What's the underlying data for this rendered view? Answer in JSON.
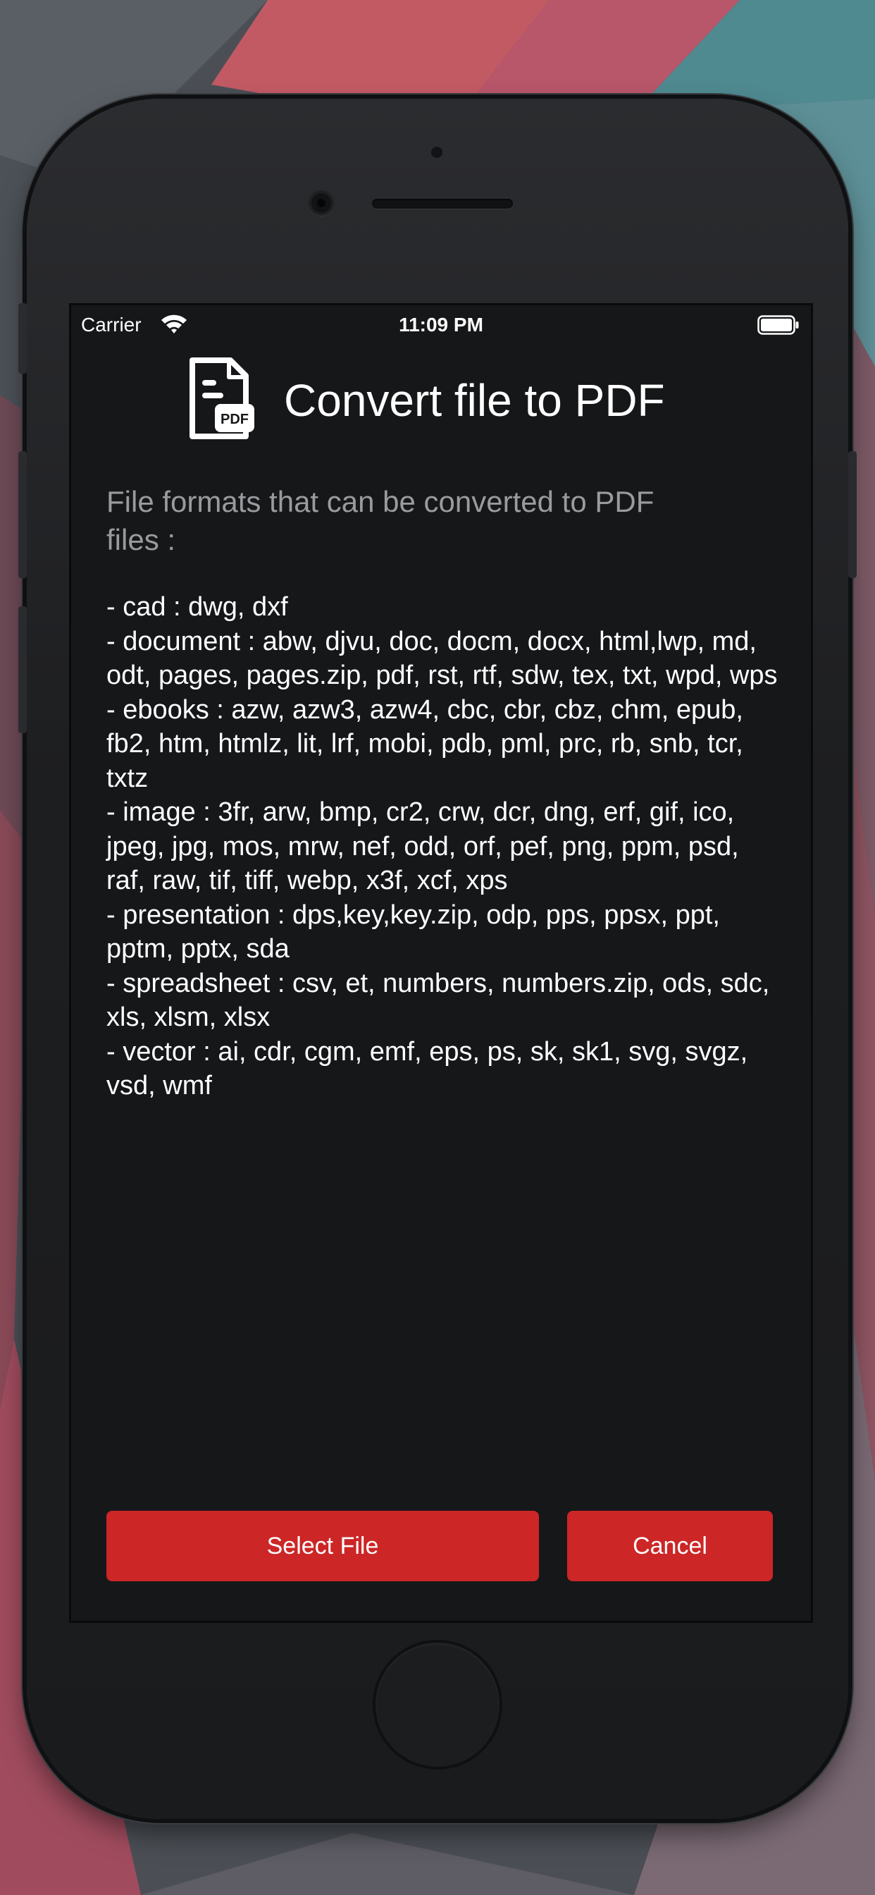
{
  "status_bar": {
    "carrier": "Carrier",
    "time": "11:09 PM",
    "wifi_icon": "wifi-icon",
    "battery_icon": "battery-icon"
  },
  "header": {
    "icon": "pdf-document-icon",
    "icon_label": "PDF",
    "title": "Convert file to PDF"
  },
  "subtitle": "File formats that can be converted to PDF files :",
  "formats": [
    "- cad : dwg, dxf",
    "- document : abw, djvu, doc, docm, docx, html,lwp, md, odt, pages, pages.zip, pdf, rst, rtf, sdw, tex, txt, wpd, wps",
    "- ebooks : azw, azw3, azw4, cbc, cbr, cbz, chm, epub, fb2, htm, htmlz, lit, lrf, mobi, pdb, pml, prc, rb, snb, tcr, txtz",
    "- image : 3fr, arw, bmp, cr2, crw, dcr, dng, erf, gif, ico, jpeg, jpg, mos, mrw, nef, odd, orf, pef, png, ppm, psd, raf, raw, tif, tiff, webp, x3f, xcf, xps",
    "- presentation : dps,key,key.zip, odp, pps, ppsx, ppt, pptm, pptx, sda",
    "- spreadsheet : csv, et, numbers, numbers.zip, ods, sdc, xls, xlsm, xlsx",
    "- vector : ai, cdr, cgm, emf, eps, ps, sk, sk1, svg, svgz, vsd, wmf"
  ],
  "buttons": {
    "select_file": "Select File",
    "cancel": "Cancel"
  },
  "colors": {
    "screen_background": "#161719",
    "accent": "#cc2626",
    "text_primary": "#ffffff",
    "text_secondary": "#9a9b9e"
  }
}
